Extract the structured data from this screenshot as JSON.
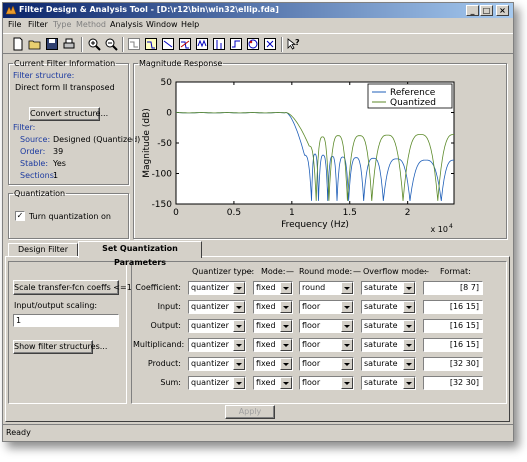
{
  "window": {
    "title": "Filter Design & Analysis Tool - [D:\\r12\\bin\\win32\\ellip.fda]",
    "minimize": "_",
    "maximize": "□",
    "close": "×"
  },
  "menu": [
    {
      "label": "File",
      "enabled": true
    },
    {
      "label": "Filter",
      "enabled": true
    },
    {
      "label": "Type",
      "enabled": false
    },
    {
      "label": "Method",
      "enabled": false
    },
    {
      "label": "Analysis",
      "enabled": true
    },
    {
      "label": "Window",
      "enabled": true
    },
    {
      "label": "Help",
      "enabled": true
    }
  ],
  "toolbar": {
    "icons": [
      "new-icon",
      "open-icon",
      "save-icon",
      "print-icon",
      "zoom-in-icon",
      "zoom-out-icon",
      "filter-specs-icon",
      "magnitude-icon",
      "phase-icon",
      "mag-phase-icon",
      "group-delay-icon",
      "impulse-icon",
      "step-icon",
      "pole-zero-icon",
      "coefficients-icon",
      "whats-this-icon"
    ]
  },
  "current_filter": {
    "legend": "Current Filter Information",
    "structure_label": "Filter structure:",
    "structure_value": "Direct form II transposed",
    "convert_button": "Convert structure...",
    "filter_label": "Filter:",
    "source_label": "Source:",
    "source_value": "Designed (Quantized)",
    "order_label": "Order:",
    "order_value": "39",
    "stable_label": "Stable:",
    "stable_value": "Yes",
    "sections_label": "Sections:",
    "sections_value": "1"
  },
  "quantization": {
    "legend": "Quantization",
    "checkbox_label": "Turn quantization on",
    "checked": true,
    "check_mark": "✓"
  },
  "magnitude_response": {
    "legend": "Magnitude Response"
  },
  "chart_data": {
    "type": "line",
    "xlabel": "Frequency (Hz)",
    "ylabel": "Magnitude (dB)",
    "x_multiplier": "x 10",
    "x_exponent": "4",
    "xlim": [
      0,
      24000
    ],
    "ylim": [
      -150,
      50
    ],
    "xticks": [
      0,
      5000,
      10000,
      15000,
      20000
    ],
    "xtick_labels": [
      "0",
      "0.5",
      "1",
      "1.5",
      "2"
    ],
    "yticks": [
      50,
      0,
      -50,
      -100,
      -150
    ],
    "ytick_labels": [
      "50",
      "0",
      "-50",
      "-100",
      "-150"
    ],
    "grid": false,
    "legend_position": "top-right",
    "series": [
      {
        "name": "Reference",
        "color": "#1f5fb8",
        "passband_db": 0,
        "passband_edge_hz": 9500,
        "nulls_hz": [
          11700,
          12300,
          13100,
          13900,
          14900,
          16200,
          17900,
          20200,
          22900
        ],
        "peaks_db": [
          -70,
          -68,
          -70,
          -72,
          -73,
          -74,
          -75,
          -76,
          -78
        ]
      },
      {
        "name": "Quantized",
        "color": "#5c8a2a",
        "passband_db": 0,
        "passband_edge_hz": 9500,
        "nulls_hz": [
          12100,
          13200,
          14800,
          16900,
          19600,
          22600
        ],
        "peaks_db": [
          -55,
          -40,
          -38,
          -38,
          -37,
          -36
        ]
      }
    ]
  },
  "tabs": [
    {
      "label": "Design Filter",
      "active": false
    },
    {
      "label": "Set Quantization Parameters",
      "active": true
    }
  ],
  "quant_params": {
    "scale_button": "Scale transfer-fcn coeffs <=1",
    "io_scaling_label": "Input/output scaling:",
    "io_scaling_value": "1",
    "show_structures_button": "Show filter structures...",
    "headers": {
      "quantizer_type": "Quantizer type:",
      "mode": "Mode:",
      "round_mode": "Round mode:",
      "overflow_mode": "Overflow mode:",
      "format": "Format:"
    },
    "rows": [
      {
        "label": "Coefficient:",
        "type": "quantizer",
        "mode": "fixed",
        "round": "round",
        "overflow": "saturate",
        "format": "[8 7]"
      },
      {
        "label": "Input:",
        "type": "quantizer",
        "mode": "fixed",
        "round": "floor",
        "overflow": "saturate",
        "format": "[16 15]"
      },
      {
        "label": "Output:",
        "type": "quantizer",
        "mode": "fixed",
        "round": "floor",
        "overflow": "saturate",
        "format": "[16 15]"
      },
      {
        "label": "Multiplicand:",
        "type": "quantizer",
        "mode": "fixed",
        "round": "floor",
        "overflow": "saturate",
        "format": "[16 15]"
      },
      {
        "label": "Product:",
        "type": "quantizer",
        "mode": "fixed",
        "round": "floor",
        "overflow": "saturate",
        "format": "[32 30]"
      },
      {
        "label": "Sum:",
        "type": "quantizer",
        "mode": "fixed",
        "round": "floor",
        "overflow": "saturate",
        "format": "[32 30]"
      }
    ],
    "apply_button": "Apply"
  },
  "status": {
    "text": "Ready"
  }
}
